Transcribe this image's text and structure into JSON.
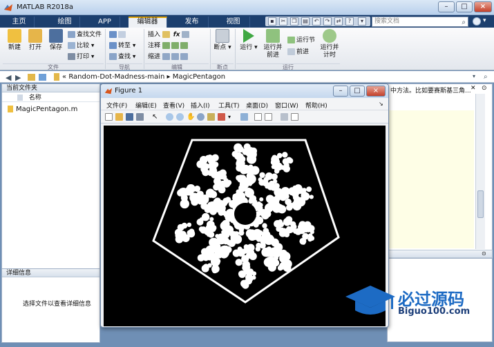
{
  "app": {
    "title": "MATLAB R2018a"
  },
  "window_controls": {
    "minimize": "–",
    "maximize": "□",
    "close": "×"
  },
  "tabs": [
    "主页",
    "绘图",
    "APP",
    "编辑器",
    "发布",
    "视图"
  ],
  "search": {
    "placeholder": "搜索文档"
  },
  "ribbon": {
    "file": {
      "new": "新建",
      "open": "打开",
      "save": "保存",
      "find_files": "查找文件",
      "compare": "比较",
      "print": "打印",
      "group": "文件"
    },
    "navigate": {
      "go_to": "转至",
      "find": "查找",
      "group": "导航"
    },
    "edit": {
      "insert": "插入",
      "comment": "注释",
      "indent": "缩进",
      "fx": "fx",
      "group": "编辑"
    },
    "breakpoints": {
      "label": "断点",
      "group": "断点"
    },
    "run": {
      "run": "运行",
      "run_advance_1": "运行并",
      "run_advance_2": "前进",
      "run_section": "运行节",
      "advance": "前进",
      "run_time_1": "运行并",
      "run_time_2": "计时",
      "group": "运行"
    }
  },
  "address": {
    "path_prefix": "«",
    "path1": "Random-Dot-Madness-main",
    "sep": "▸",
    "path2": "MagicPentagon"
  },
  "current_folder": {
    "title": "当前文件夹",
    "column": "名称",
    "files": [
      "MagicPentagon.m"
    ]
  },
  "details": {
    "title": "详细信息",
    "empty_text": "选择文件以查看详细信息"
  },
  "editor_preview": {
    "text": "中方法。比如要赛斯基三角..."
  },
  "figure": {
    "title": "Figure 1",
    "menus": [
      "文件(F)",
      "编辑(E)",
      "查看(V)",
      "插入(I)",
      "工具(T)",
      "桌面(D)",
      "窗口(W)",
      "帮助(H)"
    ]
  },
  "watermark": {
    "name": "必过源码",
    "url": "Biguo100.com"
  },
  "icons": {
    "app": "matlab-logo-icon",
    "search": "search-icon"
  }
}
